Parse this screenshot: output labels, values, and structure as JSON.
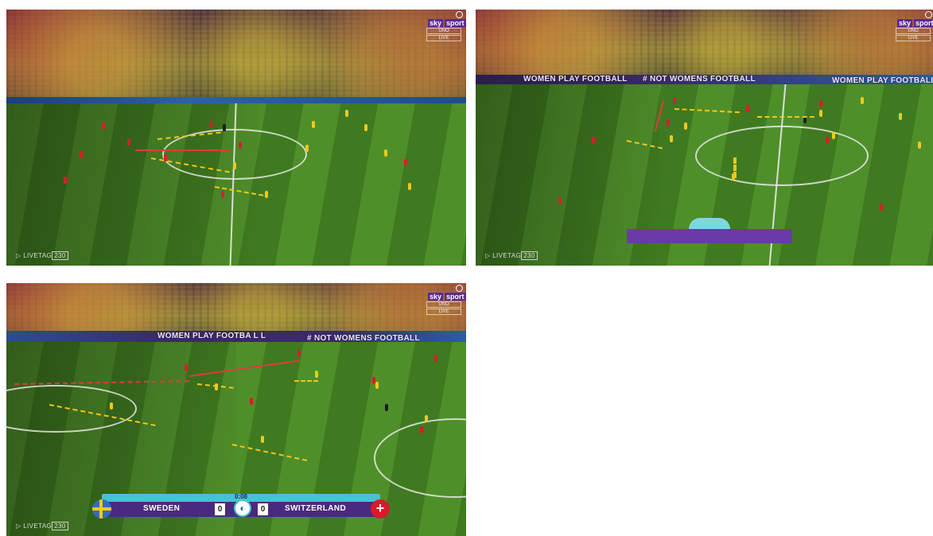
{
  "panels": [
    {
      "id": "top-left",
      "overlay": {
        "brand_sky": "sky",
        "brand_sport": "sport",
        "channel": "UNO",
        "status": "LIVE",
        "watermark_prefix": "LIVETAG",
        "watermark_suffix": "230"
      }
    },
    {
      "id": "top-right",
      "banners": [
        "WOMEN PLAY FOOTBALL",
        "# NOT WOMENS FOOTBALL",
        "WOMEN PLAY FOOTBALL"
      ],
      "overlay": {
        "brand_sky": "sky",
        "brand_sport": "sport",
        "channel": "UNO",
        "status": "LIVE",
        "watermark_prefix": "LIVETAG",
        "watermark_suffix": "230"
      }
    },
    {
      "id": "bottom-left",
      "banners": [
        "WOMEN PLAY FOOTBA L L",
        "# NOT WOMENS FOOTBALL"
      ],
      "scoreboard": {
        "time": "0:08",
        "home": "SWEDEN",
        "home_score": "0",
        "away": "SWITZERLAND",
        "away_score": "0"
      },
      "overlay": {
        "brand_sky": "sky",
        "brand_sport": "sport",
        "channel": "UNO",
        "status": "LIVE",
        "watermark_prefix": "LIVETAG",
        "watermark_suffix": "230"
      }
    }
  ],
  "colors": {
    "sweden": "#f0c81c",
    "switzerland": "#d2202e",
    "pitch": "#4f8f2a",
    "scoreboard": "#4a2a7e",
    "accent": "#46c2d3"
  },
  "icons": [
    "zoom-icon",
    "play-logo-icon",
    "ball-logo-icon",
    "sweden-flag-icon",
    "switzerland-flag-icon"
  ]
}
